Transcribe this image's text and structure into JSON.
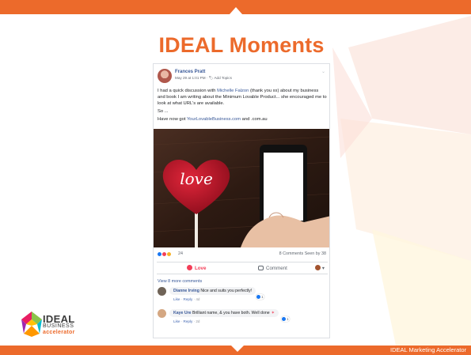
{
  "slide": {
    "title": "IDEAL Moments",
    "footer": "IDEAL Marketing Accelerator",
    "accent_color": "#ec6a2b"
  },
  "post": {
    "author": "Frances Pratt",
    "meta": "May 29 at 1:01 PM · 🏷 Add Topics",
    "menu_icon": "chevron-down-icon",
    "body": {
      "line1_pre": "I had a quick discussion with ",
      "line1_link": "Michelle Falzon",
      "line1_post": " (thank you xx) about my business and book I am writing about the Minimum Lovable Product... she encouraged me to look at what URL's are available.",
      "line2": "So ...",
      "line3_pre": "Have now got ",
      "line3_link": "YourLovableBusiness.com",
      "line3_post": " and .com.au"
    },
    "photo": {
      "lollipop_text": "love",
      "description_icon": "heart-lollipop-and-phone-image"
    },
    "reactions": {
      "count": "24",
      "summary": "8 Comments  Seen by 38",
      "icons": [
        "like-icon",
        "love-icon",
        "wow-icon"
      ]
    },
    "actions": {
      "love": "Love",
      "comment": "Comment",
      "more": "▾"
    },
    "view_more": "View 8 more comments",
    "comments": [
      {
        "name": "Dianne Irving",
        "text": " Nice and suits you perfectly!",
        "like": "Like",
        "reply": "Reply",
        "time": "4d",
        "likes": "1"
      },
      {
        "name": "Kaye Ure",
        "text": " Brilliant name, & you have both. Well done",
        "like": "Like",
        "reply": "Reply",
        "time": "2d",
        "likes": "1"
      }
    ]
  },
  "logo": {
    "word": "IDEAL",
    "sub": "BUSINESS",
    "acc": "accelerator"
  }
}
